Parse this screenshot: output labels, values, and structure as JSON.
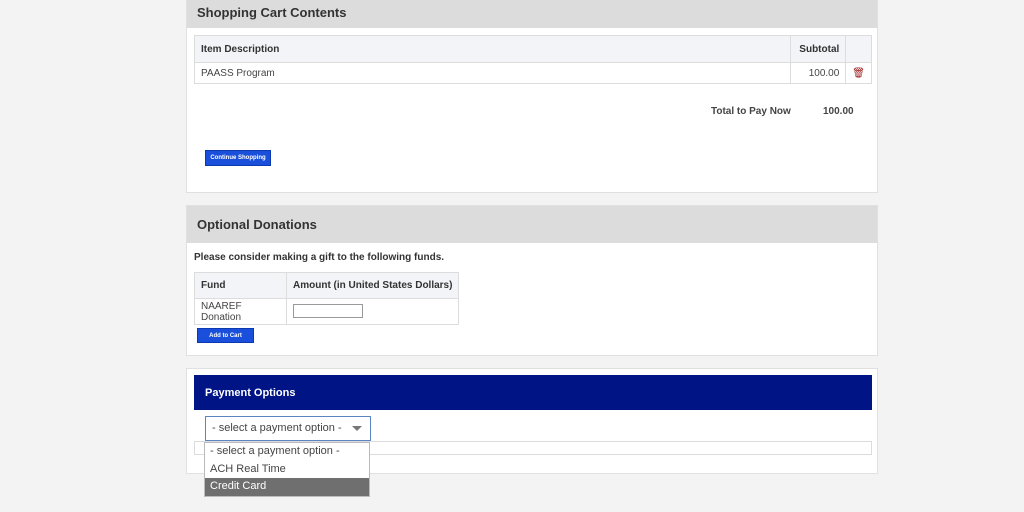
{
  "cart": {
    "title": "Shopping Cart Contents",
    "columns": [
      "Item Description",
      "Subtotal"
    ],
    "rows": [
      {
        "description": "PAASS Program",
        "subtotal": "100.00"
      }
    ],
    "total_label": "Total to Pay Now",
    "total_value": "100.00",
    "continue_label": "Continue Shopping"
  },
  "donations": {
    "title": "Optional Donations",
    "intro": "Please consider making a gift to the following funds.",
    "columns": [
      "Fund",
      "Amount (in United States Dollars)"
    ],
    "rows": [
      {
        "fund": "NAAREF Donation",
        "amount": ""
      }
    ],
    "add_label": "Add to Cart"
  },
  "payment": {
    "title": "Payment Options",
    "selected": "- select a payment option -",
    "options": [
      "- select a payment option -",
      "ACH Real Time",
      "Credit Card"
    ],
    "highlighted_index": 2
  },
  "colors": {
    "accent_blue": "#1a4fdb",
    "payment_header": "#001486",
    "trash_icon": "#9b1a1a"
  }
}
